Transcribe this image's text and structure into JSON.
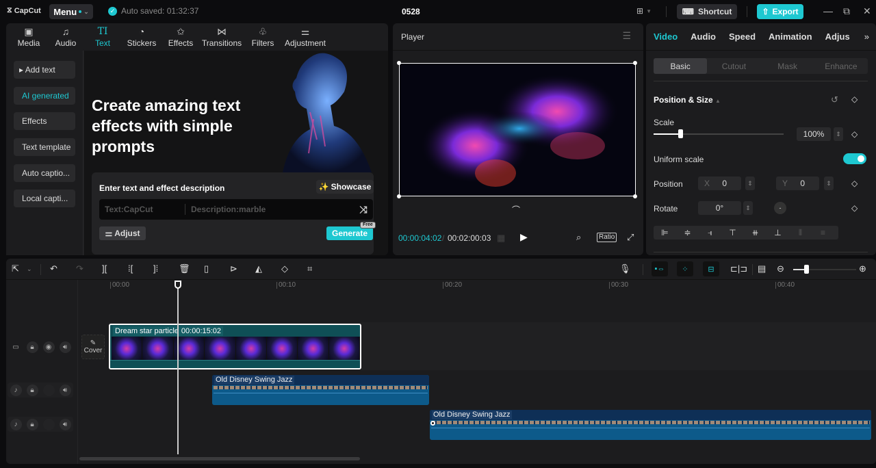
{
  "app": {
    "logo": "CapCut",
    "menu_label": "Menu",
    "autosave": "Auto saved: 01:32:37",
    "project_title": "0528",
    "shortcut_label": "Shortcut",
    "export_label": "Export",
    "accent_color": "#1ec8d1"
  },
  "left_panel": {
    "tabs": [
      {
        "label": "Media",
        "icon": "media-icon"
      },
      {
        "label": "Audio",
        "icon": "audio-icon"
      },
      {
        "label": "Text",
        "icon": "text-icon",
        "active": true
      },
      {
        "label": "Stickers",
        "icon": "sticker-icon"
      },
      {
        "label": "Effects",
        "icon": "effects-icon"
      },
      {
        "label": "Transitions",
        "icon": "transitions-icon"
      },
      {
        "label": "Filters",
        "icon": "filters-icon"
      },
      {
        "label": "Adjustment",
        "icon": "adjustment-icon"
      }
    ],
    "tab_glyphs": [
      "▣",
      "♫",
      "TI",
      "◔",
      "✩",
      "⋈",
      "♧",
      "⚌"
    ],
    "nav": [
      {
        "label": "▸ Add text"
      },
      {
        "label": "AI generated",
        "active": true
      },
      {
        "label": "Effects"
      },
      {
        "label": "Text template"
      },
      {
        "label": "Auto captio..."
      },
      {
        "label": "Local capti..."
      }
    ],
    "hero_title": "Create amazing text effects with simple prompts",
    "prompt": {
      "label": "Enter text and effect description",
      "showcase_label": "Showcase",
      "text_placeholder": "Text:CapCut",
      "description_placeholder": "Description:marble",
      "adjust_label": "Adjust",
      "generate_label": "Generate",
      "free_badge": "Free"
    }
  },
  "player": {
    "title": "Player",
    "current_time": "00:00:04:02",
    "total_time": "00:02:00:03",
    "ratio_label": "Ratio"
  },
  "right_panel": {
    "tabs": [
      {
        "label": "Video",
        "active": true
      },
      {
        "label": "Audio"
      },
      {
        "label": "Speed"
      },
      {
        "label": "Animation"
      },
      {
        "label": "Adjus"
      }
    ],
    "subtabs": [
      {
        "label": "Basic",
        "active": true
      },
      {
        "label": "Cutout"
      },
      {
        "label": "Mask"
      },
      {
        "label": "Enhance"
      }
    ],
    "section_title": "Position & Size",
    "scale_label": "Scale",
    "scale_value": "100%",
    "scale_slider_fraction": 0.2,
    "uniform_scale_label": "Uniform scale",
    "uniform_scale_on": true,
    "position_label": "Position",
    "x_label": "X",
    "x_value": "0",
    "y_label": "Y",
    "y_value": "0",
    "rotate_label": "Rotate",
    "rotate_value": "0°",
    "align_glyphs": [
      "⊫",
      "≑",
      "⫣",
      "⊤",
      "⧺",
      "⊥",
      "⦀",
      "≡"
    ]
  },
  "timeline": {
    "ruler": [
      "00:00",
      "00:10",
      "00:20",
      "00:30",
      "00:40"
    ],
    "zoom_fraction": 0.2,
    "cover_label": "Cover",
    "video_clip": {
      "name": "Dream star particle",
      "duration": "00:00:15:02"
    },
    "audio_clips": [
      {
        "name": "Old Disney Swing Jazz"
      },
      {
        "name": "Old Disney Swing Jazz"
      }
    ]
  }
}
